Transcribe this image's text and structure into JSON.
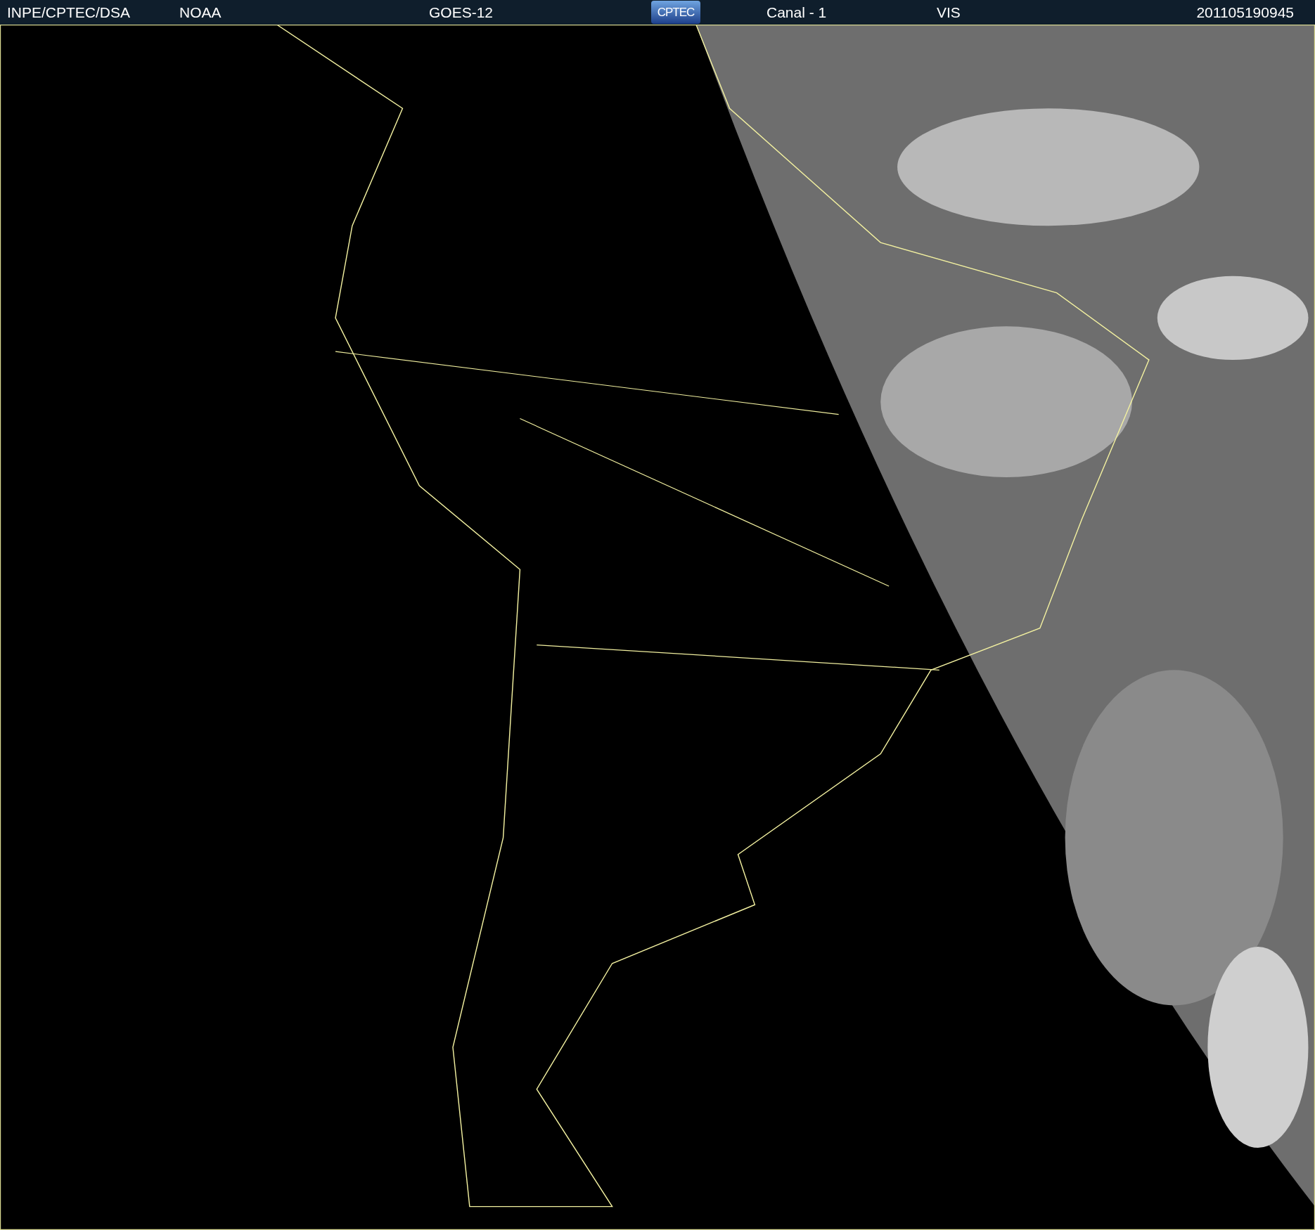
{
  "header": {
    "agency": "INPE/CPTEC/DSA",
    "source": "NOAA",
    "satellite": "GOES-12",
    "logo": "CPTEC",
    "channel": "Canal - 1",
    "band": "VIS",
    "timestamp": "201105190945"
  }
}
